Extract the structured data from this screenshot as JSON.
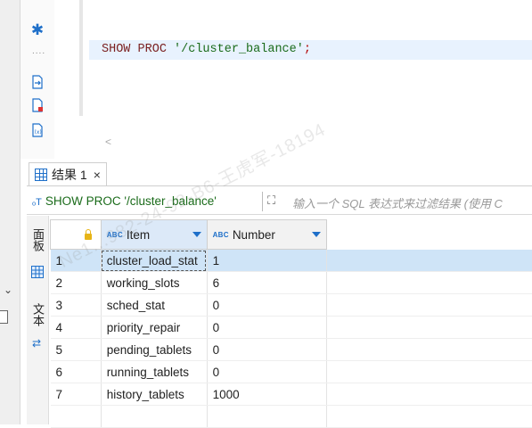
{
  "editor": {
    "sql_keyword1": "SHOW",
    "sql_keyword2": "PROC",
    "sql_string": "'/cluster_balance'",
    "sql_terminator": ";",
    "hscroll_glyph": "<"
  },
  "watermark": "Ne1...982-24-92-B6-王虎军-18194",
  "result_tab": {
    "label": "结果 1",
    "close": "×"
  },
  "filter_bar": {
    "query_text": "SHOW PROC '/cluster_balance'",
    "query_icon": "ₒT",
    "placeholder": "输入一个 SQL 表达式来过滤结果 (使用 C"
  },
  "side_tabs": {
    "panel": "面板",
    "text": "文本"
  },
  "grid": {
    "columns": [
      {
        "label": "Item",
        "type_badge": "ABC"
      },
      {
        "label": "Number",
        "type_badge": "ABC"
      }
    ],
    "rows": [
      {
        "n": "1",
        "item": "cluster_load_stat",
        "number": "1"
      },
      {
        "n": "2",
        "item": "working_slots",
        "number": "6"
      },
      {
        "n": "3",
        "item": "sched_stat",
        "number": "0"
      },
      {
        "n": "4",
        "item": "priority_repair",
        "number": "0"
      },
      {
        "n": "5",
        "item": "pending_tablets",
        "number": "0"
      },
      {
        "n": "6",
        "item": "running_tablets",
        "number": "0"
      },
      {
        "n": "7",
        "item": "history_tablets",
        "number": "1000"
      }
    ]
  },
  "colors": {
    "accent": "#1e6fc9",
    "selected_row": "#cfe4f7",
    "current_line": "#e8f2fe",
    "sql_string": "#1a6b1a"
  }
}
